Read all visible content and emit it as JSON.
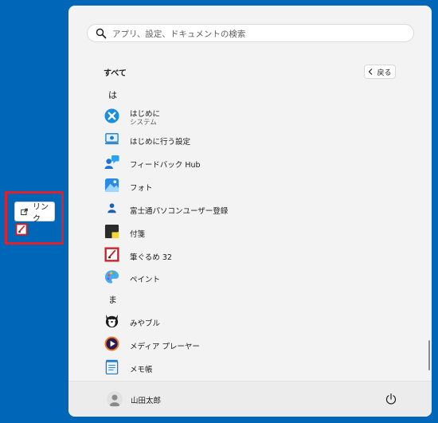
{
  "search": {
    "placeholder": "アプリ、設定、ドキュメントの検索"
  },
  "list": {
    "header": "すべて",
    "back_label": "戻る"
  },
  "sections": [
    {
      "letter": "は"
    },
    {
      "letter": "ま"
    }
  ],
  "apps": [
    {
      "name": "はじめに",
      "sub": "システム",
      "icon": "get-started-icon"
    },
    {
      "name": "はじめに行う設定",
      "icon": "initial-setup-icon"
    },
    {
      "name": "フィードバック Hub",
      "icon": "feedback-hub-icon"
    },
    {
      "name": "フォト",
      "icon": "photos-icon"
    },
    {
      "name": "富士通パソコンユーザー登録",
      "icon": "user-registration-icon"
    },
    {
      "name": "付箋",
      "icon": "sticky-notes-icon"
    },
    {
      "name": "筆ぐるめ 32",
      "icon": "fudegurume-icon"
    },
    {
      "name": "ペイント",
      "icon": "paint-icon"
    },
    {
      "name": "みやブル",
      "icon": "miyaburu-icon"
    },
    {
      "name": "メディア プレーヤー",
      "icon": "media-player-icon"
    },
    {
      "name": "メモ帳",
      "icon": "notepad-icon"
    }
  ],
  "user": {
    "name": "山田太郎"
  },
  "drag": {
    "tooltip_label": "リンク"
  },
  "colors": {
    "desktop": "#0066b8",
    "highlight": "#e0202c",
    "menu_bg": "#f3f3f3"
  }
}
